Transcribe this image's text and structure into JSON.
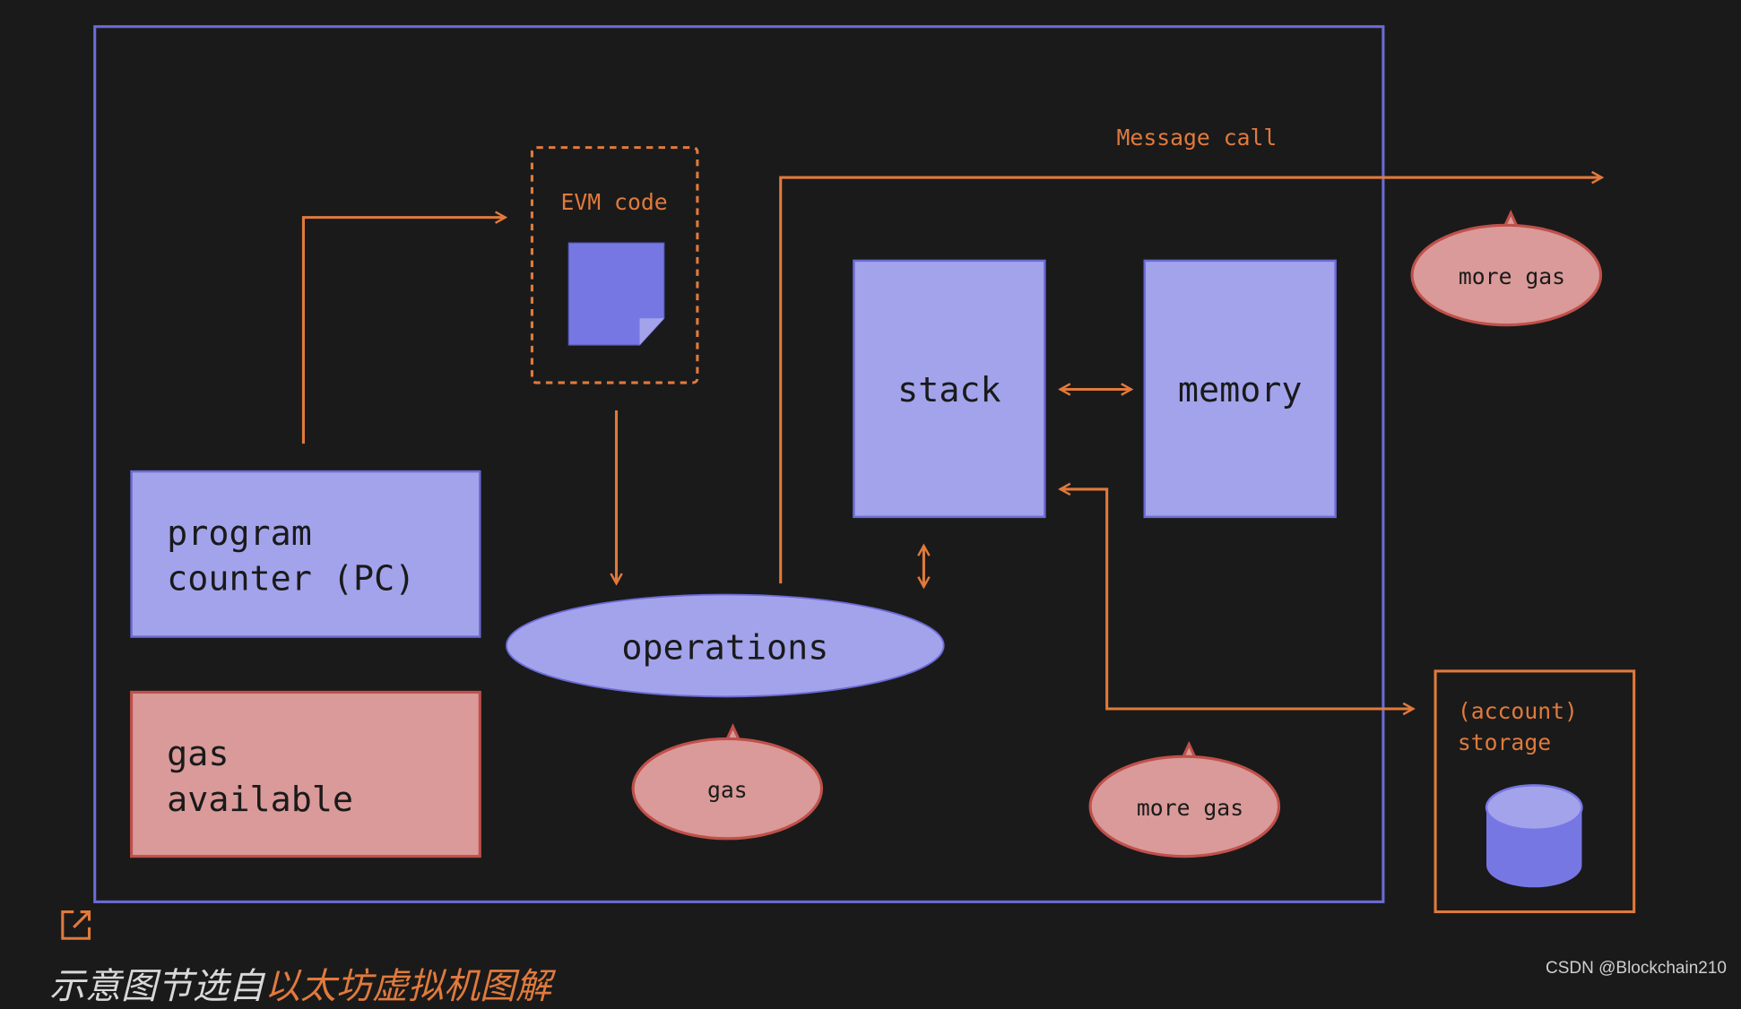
{
  "diagram": {
    "evm_code_label": "EVM code",
    "message_call_label": "Message call",
    "stack_label": "stack",
    "memory_label": "memory",
    "pc_label_line1": "program",
    "pc_label_line2": "counter (PC)",
    "gas_available_line1": "gas",
    "gas_available_line2": "available",
    "operations_label": "operations",
    "gas_label": "gas",
    "more_gas_top_label": "more gas",
    "more_gas_bottom_label": "more gas",
    "storage_line1": "(account)",
    "storage_line2": "storage"
  },
  "caption": {
    "prefix": "示意图节选自",
    "link_text": "以太坊虚拟机图解"
  },
  "watermark": "CSDN @Blockchain210",
  "colors": {
    "background": "#1a1a1a",
    "frame": "#6b6bd6",
    "box_purple": "#a3a3ec",
    "doc_purple": "#7777e4",
    "gas_red": "#d99a99",
    "gas_border": "#c0504a",
    "orange": "#e07a3c"
  }
}
